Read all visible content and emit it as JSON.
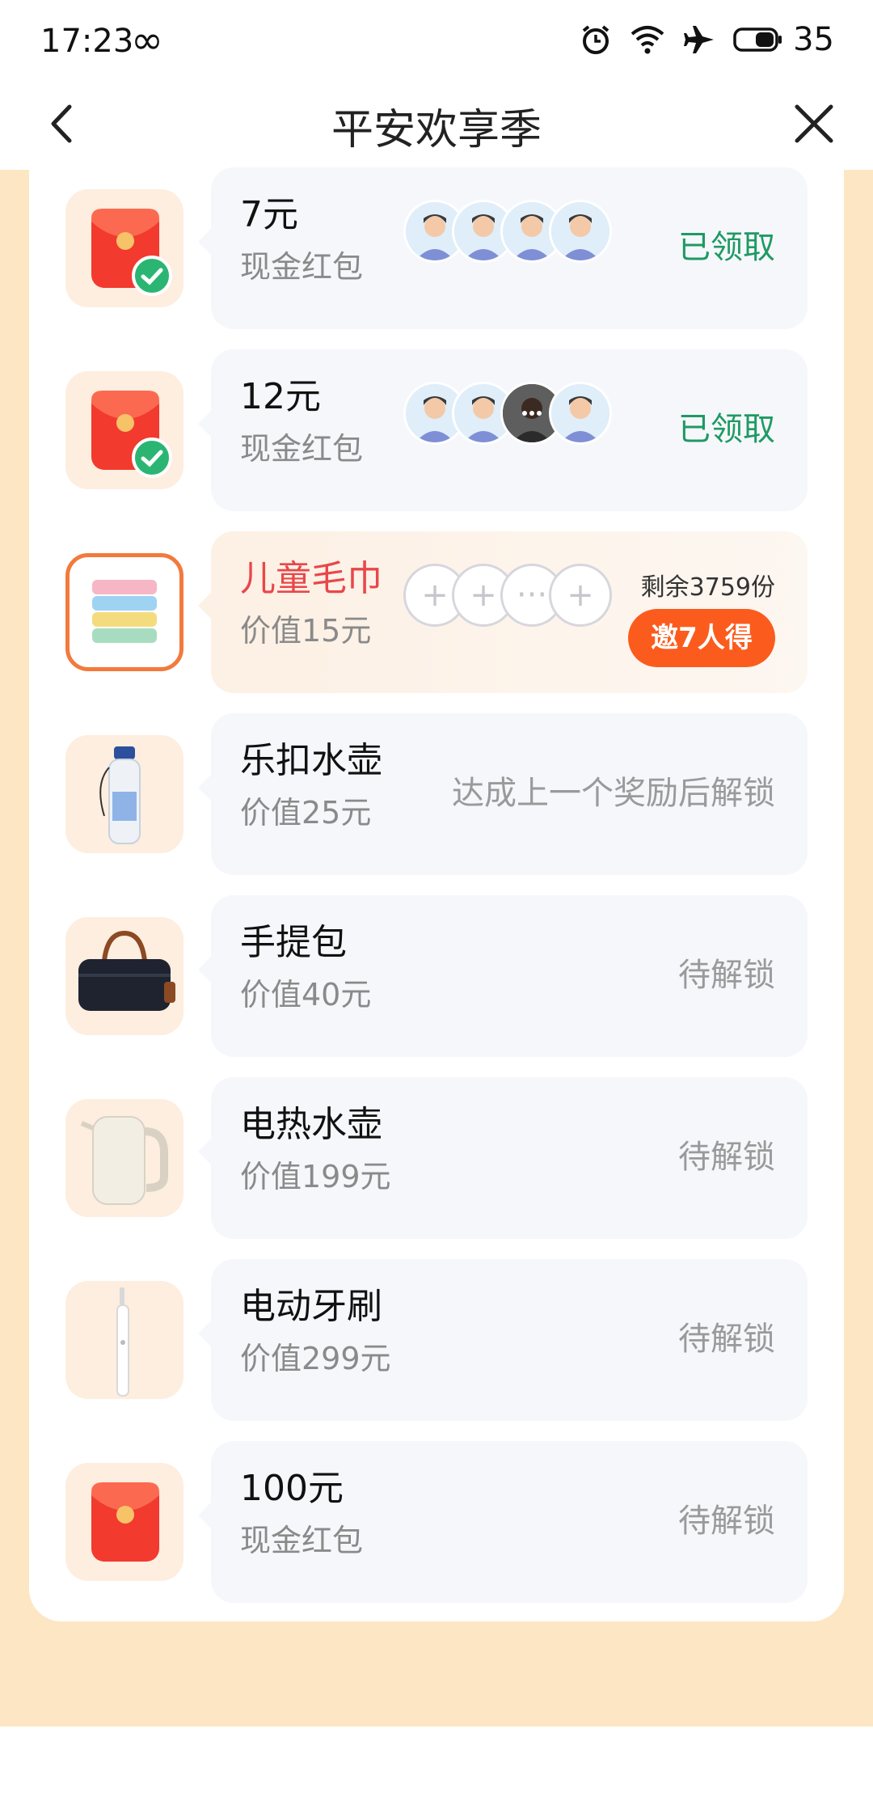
{
  "status_bar": {
    "time": "17:23",
    "battery": "35",
    "icons": [
      "infinity-icon",
      "alarm-icon",
      "wifi-icon",
      "airplane-icon",
      "battery-icon"
    ]
  },
  "nav": {
    "title": "平安欢享季",
    "back_icon": "chevron-left-icon",
    "close_icon": "close-icon"
  },
  "rewards": [
    {
      "name": "7元",
      "sub": "现金红包",
      "status": "已领取",
      "state": "claimed",
      "icon": "red-envelope-icon"
    },
    {
      "name": "12元",
      "sub": "现金红包",
      "status": "已领取",
      "state": "claimed",
      "icon": "red-envelope-icon"
    },
    {
      "name": "儿童毛巾",
      "sub": "价值15元",
      "remaining": "剩余3759份",
      "button": "邀7人得",
      "state": "active",
      "icon": "towel-icon",
      "slot_plus": "+",
      "slot_more": "···"
    },
    {
      "name": "乐扣水壶",
      "sub": "价值25元",
      "status": "达成上一个奖励后解锁",
      "state": "next",
      "icon": "water-bottle-icon"
    },
    {
      "name": "手提包",
      "sub": "价值40元",
      "status": "待解锁",
      "state": "locked",
      "icon": "handbag-icon"
    },
    {
      "name": "电热水壶",
      "sub": "价值199元",
      "status": "待解锁",
      "state": "locked",
      "icon": "kettle-icon"
    },
    {
      "name": "电动牙刷",
      "sub": "价值299元",
      "status": "待解锁",
      "state": "locked",
      "icon": "toothbrush-icon"
    },
    {
      "name": "100元",
      "sub": "现金红包",
      "status": "待解锁",
      "state": "locked",
      "icon": "red-envelope-icon"
    }
  ],
  "colors": {
    "accent_orange": "#fb5c1e",
    "claimed_green": "#1f9a63",
    "highlight_red": "#e8474a",
    "background_peach": "#fde6c4"
  }
}
